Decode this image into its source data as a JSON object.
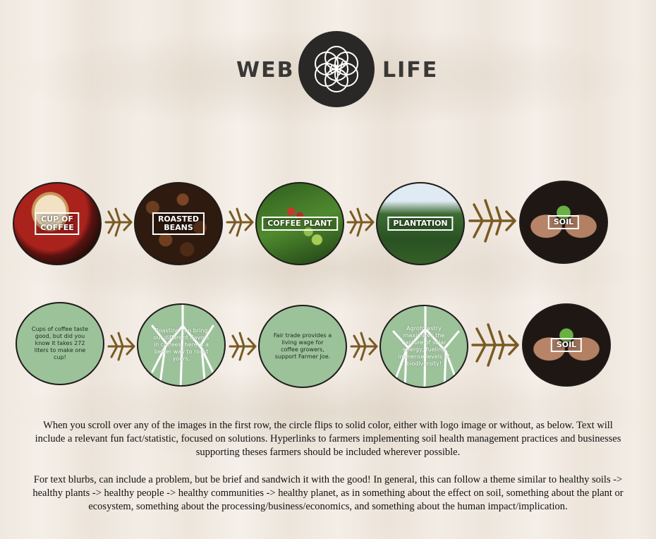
{
  "logo": {
    "word_left": "WEB",
    "word_right": "LIFE",
    "center_glyph": "of"
  },
  "row1": [
    {
      "label": "CUP OF\nCOFFEE"
    },
    {
      "label": "ROASTED\nBEANS"
    },
    {
      "label": "COFFEE PLANT"
    },
    {
      "label": "PLANTATION"
    },
    {
      "label": "SOIL"
    }
  ],
  "row2": [
    {
      "text": "Cups of coffee taste good, but did you know it takes 272 liters to make one cup!"
    },
    {
      "text": "Roasting can bring out different flavors in coffees, here is a better way to roast yours."
    },
    {
      "text": "Fair trade provides a living wage for coffee growers, support Farmer Joe."
    },
    {
      "text": "Agroforestry maximizes the capture of solar energy, fueling immense levels of biodiversity!"
    },
    {
      "label": "SOIL"
    }
  ],
  "description": {
    "p1": "When you scroll over any of the images in the first row, the circle flips to solid color, either with logo image or without, as below. Text will include a relevant fun fact/statistic, focused on solutions. Hyperlinks to farmers implementing soil health management practices and businesses supporting theses farmers should be included wherever possible.",
    "p2": "For text blurbs, can include a problem, but be brief  and sandwich it with the good! In general, this can follow a theme similar to healthy soils -> healthy plants -> healthy people -> healthy communities -> healthy planet, as in something about the effect on soil, something about the plant or ecosystem, something about the processing/business/economics, and something about the human impact/implication."
  },
  "colors": {
    "green_circle": "#9cc29a",
    "root_brown": "#7a5a22",
    "logo_dark": "#2a2827"
  },
  "icons": [
    "root-arrow-icon",
    "flower-of-life-icon"
  ]
}
